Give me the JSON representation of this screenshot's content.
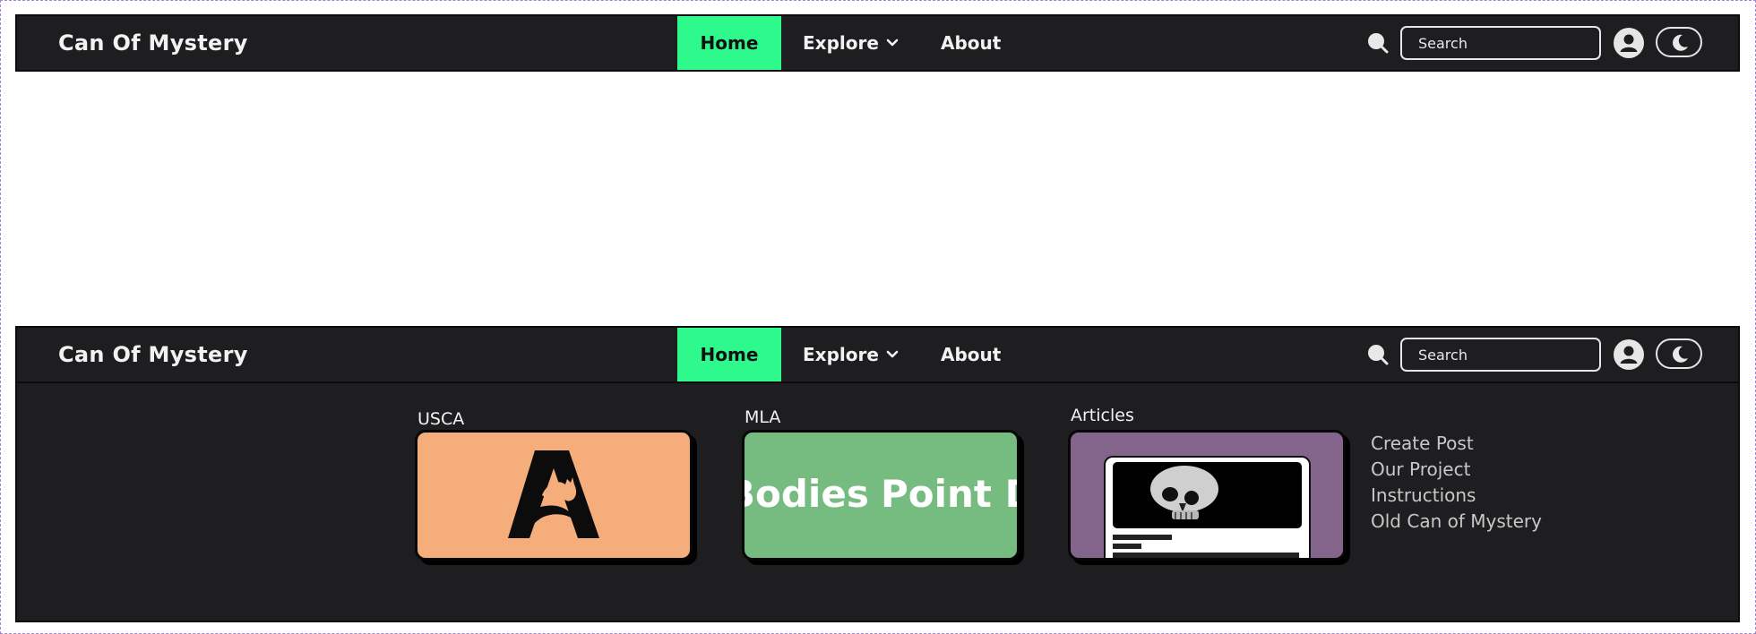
{
  "brand": "Can Of Mystery",
  "nav": {
    "home": "Home",
    "explore": "Explore",
    "about": "About"
  },
  "search": {
    "placeholder": "Search"
  },
  "colors": {
    "navbar": "#1e1d1f",
    "active_nav": "#2df98c",
    "usca_card": "#f4ad7b",
    "mla_card": "#76bb7f",
    "articles_card": "#83658b"
  },
  "icons": {
    "search": "search-icon",
    "user": "user-icon",
    "theme": "moon-icon",
    "explore": "chevron-down-icon"
  },
  "dropdown": {
    "cards": [
      {
        "label": "USCA"
      },
      {
        "label": "MLA",
        "marquee_left": "Bodies",
        "marquee_right": "Point D"
      },
      {
        "label": "Articles"
      }
    ],
    "links": [
      "Create Post",
      "Our Project",
      "Instructions",
      "Old Can of Mystery"
    ]
  }
}
